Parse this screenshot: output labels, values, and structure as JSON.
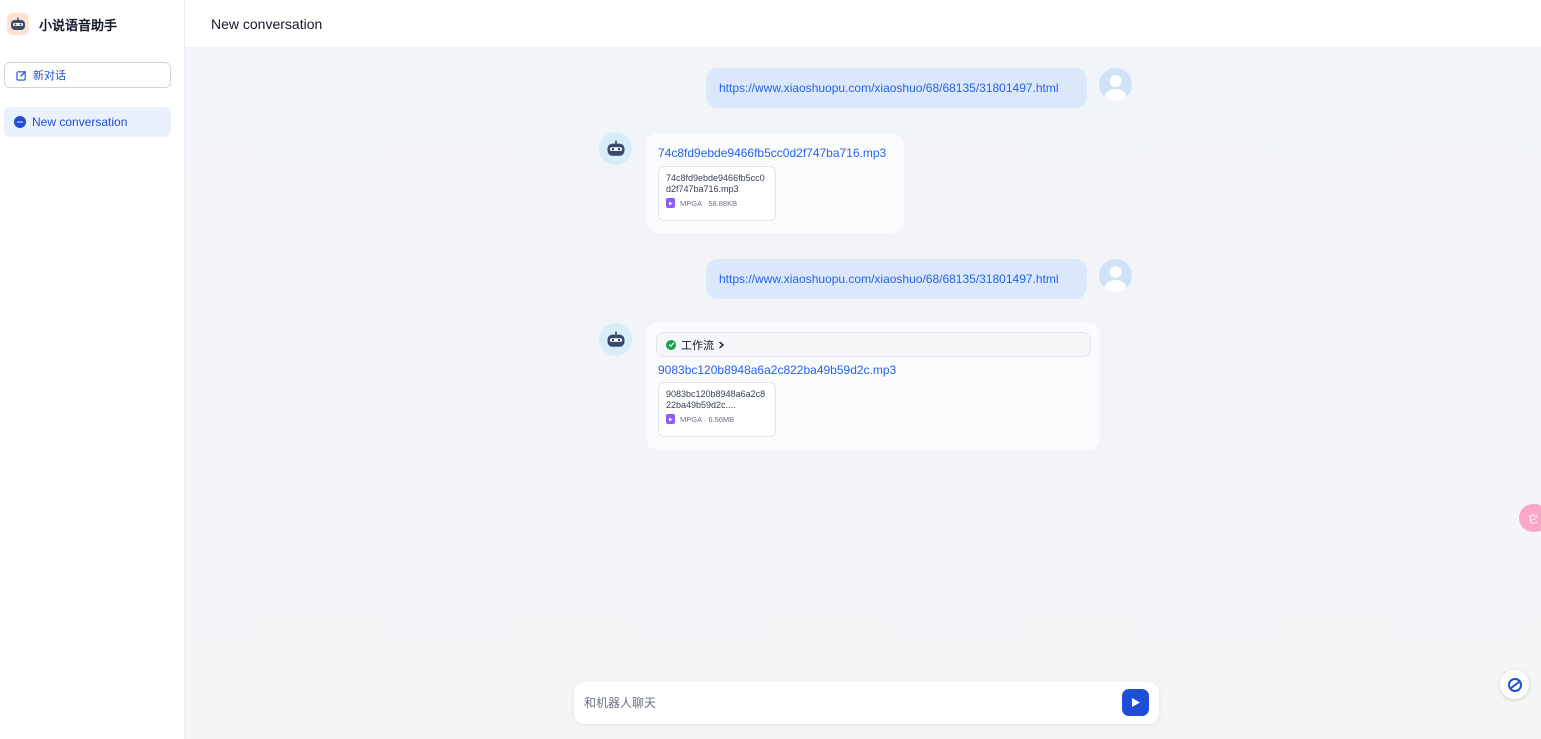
{
  "app": {
    "title": "小说语音助手"
  },
  "sidebar": {
    "new_chat_label": "新对话",
    "conversations": [
      {
        "label": "New conversation"
      }
    ]
  },
  "header": {
    "title": "New conversation"
  },
  "messages": [
    {
      "role": "user",
      "text": "https://www.xiaoshuopu.com/xiaoshuo/68/68135/31801497.html"
    },
    {
      "role": "assistant",
      "file_link": "74c8fd9ebde9466fb5cc0d2f747ba716.mp3",
      "file": {
        "name": "74c8fd9ebde9466fb5cc0d2f747ba716.mp3",
        "type": "MPGA",
        "size": "58.88KB",
        "meta": "MPGA · 58.88KB"
      }
    },
    {
      "role": "user",
      "text": "https://www.xiaoshuopu.com/xiaoshuo/68/68135/31801497.html"
    },
    {
      "role": "assistant",
      "workflow_label": "工作流",
      "file_link": "9083bc120b8948a6a2c822ba49b59d2c.mp3",
      "file": {
        "name": "9083bc120b8948a6a2c822ba49b59d2c....",
        "type": "MPGA",
        "size": "6.56MB",
        "meta": "MPGA · 6.56MB"
      }
    }
  ],
  "input": {
    "placeholder": "和机器人聊天",
    "value": ""
  },
  "float_pink_label": "它",
  "icons": {
    "app_logo": "robot-icon",
    "new_chat": "edit-icon",
    "conversation": "chat-bubble-icon",
    "user_avatar": "user-avatar-icon",
    "bot_avatar": "robot-icon",
    "file": "audio-file-icon",
    "workflow_status": "check-circle-icon",
    "workflow_expand": "chevron-right-icon",
    "send": "send-icon",
    "help": "help-icon"
  },
  "colors": {
    "accent": "#1d4ed8",
    "link": "#2563eb",
    "user_bubble": "#dbe8fb",
    "success": "#16a34a",
    "file_icon": "#8b5cf6"
  }
}
